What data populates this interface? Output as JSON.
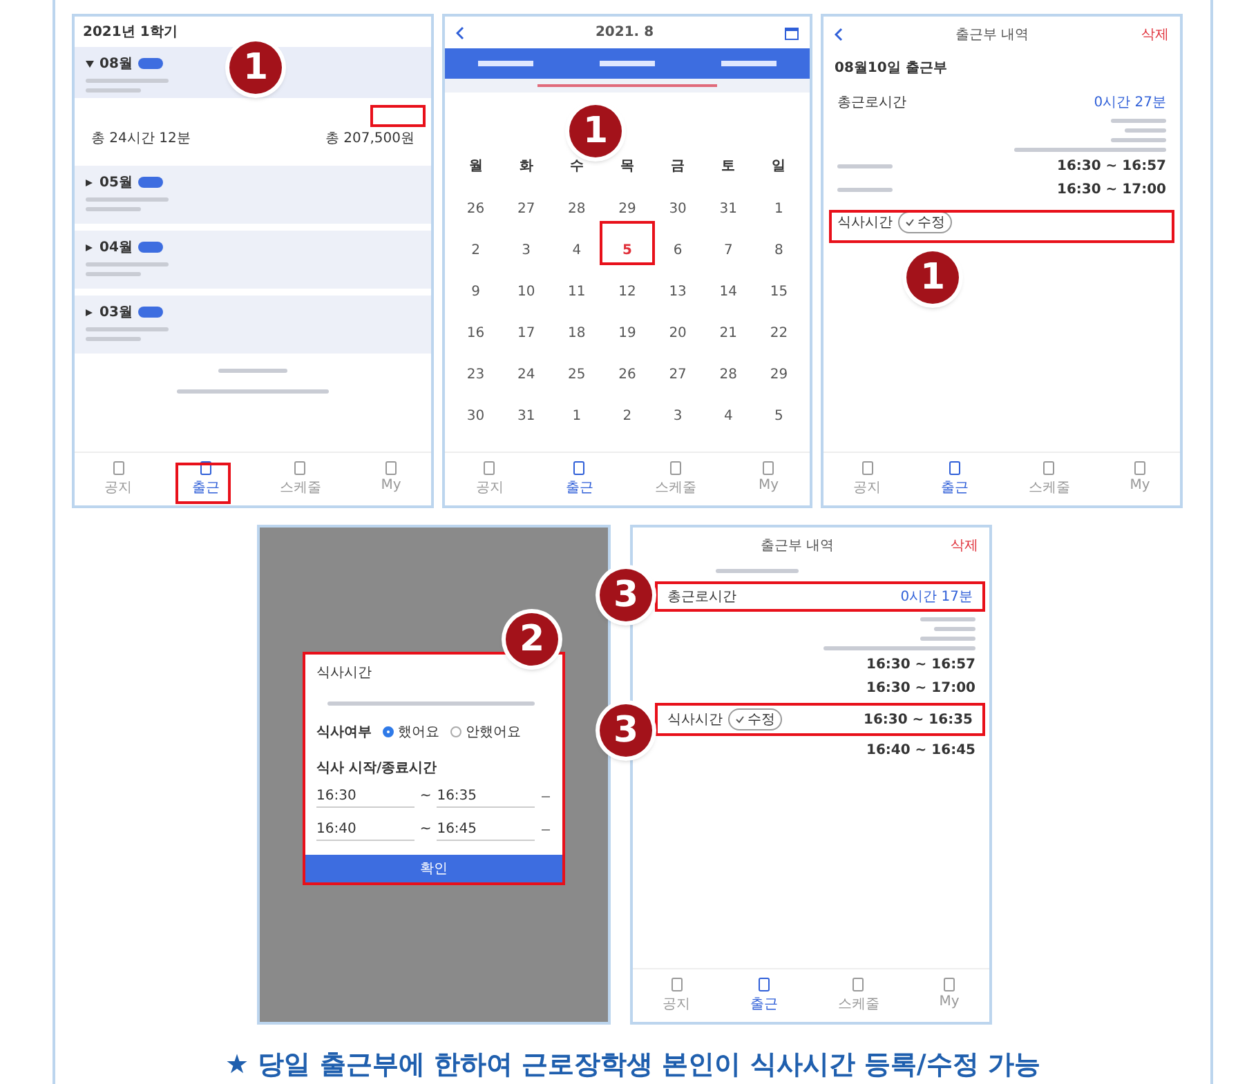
{
  "semester_screen": {
    "title": "2021년 1학기",
    "markers": [
      "1"
    ],
    "months": [
      {
        "label": "08월",
        "expanded": true,
        "summary": [
          "총 24시간 12분",
          "총 207,500원"
        ]
      },
      {
        "label": "05월",
        "expanded": false
      },
      {
        "label": "04월",
        "expanded": false
      },
      {
        "label": "03월",
        "expanded": false
      }
    ],
    "tabs": [
      {
        "label": "공지",
        "selected": false
      },
      {
        "label": "출근",
        "selected": true
      },
      {
        "label": "스케줄",
        "selected": false
      },
      {
        "label": "My",
        "selected": false
      }
    ]
  },
  "calendar_screen": {
    "title": "2021. 8",
    "markers": [
      "1"
    ],
    "weekdays": [
      "월",
      "화",
      "수",
      "목",
      "금",
      "토",
      "일"
    ],
    "weeks": [
      [
        {
          "d": "26",
          "today": false
        },
        {
          "d": "27",
          "today": false
        },
        {
          "d": "28",
          "today": false
        },
        {
          "d": "29",
          "today": false
        },
        {
          "d": "30",
          "today": false
        },
        {
          "d": "31",
          "today": false
        },
        {
          "d": "1",
          "today": false
        }
      ],
      [
        {
          "d": "2",
          "today": false
        },
        {
          "d": "3",
          "today": false
        },
        {
          "d": "4",
          "today": false
        },
        {
          "d": "5",
          "today": true
        },
        {
          "d": "6",
          "today": false
        },
        {
          "d": "7",
          "today": false
        },
        {
          "d": "8",
          "today": false
        }
      ],
      [
        {
          "d": "9",
          "today": false
        },
        {
          "d": "10",
          "today": false
        },
        {
          "d": "11",
          "today": false
        },
        {
          "d": "12",
          "today": false
        },
        {
          "d": "13",
          "today": false
        },
        {
          "d": "14",
          "today": false
        },
        {
          "d": "15",
          "today": false
        }
      ],
      [
        {
          "d": "16",
          "today": false
        },
        {
          "d": "17",
          "today": false
        },
        {
          "d": "18",
          "today": false
        },
        {
          "d": "19",
          "today": false
        },
        {
          "d": "20",
          "today": false
        },
        {
          "d": "21",
          "today": false
        },
        {
          "d": "22",
          "today": false
        }
      ],
      [
        {
          "d": "23",
          "today": false
        },
        {
          "d": "24",
          "today": false
        },
        {
          "d": "25",
          "today": false
        },
        {
          "d": "26",
          "today": false
        },
        {
          "d": "27",
          "today": false
        },
        {
          "d": "28",
          "today": false
        },
        {
          "d": "29",
          "today": false
        }
      ],
      [
        {
          "d": "30",
          "today": false
        },
        {
          "d": "31",
          "today": false
        },
        {
          "d": "1",
          "today": false
        },
        {
          "d": "2",
          "today": false
        },
        {
          "d": "3",
          "today": false
        },
        {
          "d": "4",
          "today": false
        },
        {
          "d": "5",
          "today": false
        }
      ]
    ],
    "tabs": [
      {
        "label": "공지",
        "selected": false
      },
      {
        "label": "출근",
        "selected": true
      },
      {
        "label": "스케줄",
        "selected": false
      },
      {
        "label": "My",
        "selected": false
      }
    ]
  },
  "detail_screen": {
    "title": "출근부 내역",
    "delete": "삭제",
    "heading": "08월10일 출근부",
    "markers": [
      "1"
    ],
    "total_label": "총근로시간",
    "total": "0시간 27분",
    "times": [
      "16:30 ~ 16:57",
      "16:30 ~ 17:00"
    ],
    "meal_label": "식사시간",
    "edit_chip": "수정",
    "tabs": [
      {
        "label": "공지",
        "selected": false
      },
      {
        "label": "출근",
        "selected": true
      },
      {
        "label": "스케줄",
        "selected": false
      },
      {
        "label": "My",
        "selected": false
      }
    ]
  },
  "meal_dialog_screen": {
    "markers": [
      "2"
    ],
    "dialog": {
      "title": "식사시간",
      "question": "식사여부",
      "options": [
        {
          "label": "했어요",
          "selected": true
        },
        {
          "label": "안했어요",
          "selected": false
        }
      ],
      "section": "식사 시작/종료시간",
      "separator": "~",
      "rows": [
        [
          "16:30",
          "16:35"
        ],
        [
          "16:40",
          "16:45"
        ]
      ],
      "confirm": "확인"
    }
  },
  "result_screen": {
    "title": "출근부 내역",
    "delete": "삭제",
    "markers": [
      "3",
      "3"
    ],
    "total_label": "총근로시간",
    "total": "0시간 17분",
    "times": [
      "16:30 ~ 16:57",
      "16:30 ~ 17:00",
      "16:30 ~ 16:35",
      "16:40 ~ 16:45"
    ],
    "meal_label": "식사시간",
    "edit_chip": "수정",
    "tabs": [
      {
        "label": "공지",
        "selected": false
      },
      {
        "label": "출근",
        "selected": true
      },
      {
        "label": "스케줄",
        "selected": false
      },
      {
        "label": "My",
        "selected": false
      }
    ]
  },
  "caption": {
    "mark": "★",
    "text": "당일 출근부에 한하여 근로장학생 본인이 식사시간 등록/수정 가능"
  }
}
